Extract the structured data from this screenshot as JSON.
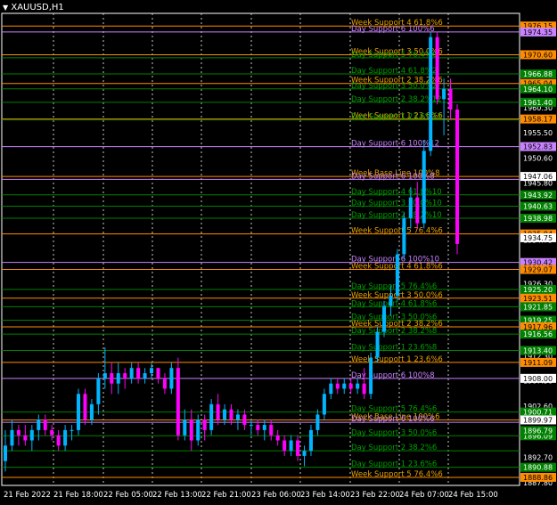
{
  "window": {
    "symbol_label": "XAUUSD,H1",
    "menu_icon": "triangle-down-icon"
  },
  "colors": {
    "background": "#000000",
    "grid": "#c8c8c8",
    "bull": "#00b4ff",
    "bear": "#ff00ff",
    "week_line": "#ff8c00",
    "day_line": "#c882ff",
    "green_line": "#008000",
    "week_text": "#e6a000",
    "day_text": "#c882ff",
    "green_text": "#00a000",
    "badge_green": "#008000",
    "badge_orange": "#ff8c00",
    "badge_violet": "#c882ff",
    "badge_white": "#ffffff"
  },
  "chart_data": {
    "type": "candlestick",
    "symbol": "XAUUSD",
    "timeframe": "H1",
    "ylim": [
      1887.3,
      1978.6
    ],
    "x_tick_labels": [
      "21 Feb 2022",
      "21 Feb 18:00",
      "22 Feb 05:00",
      "22 Feb 13:00",
      "22 Feb 21:00",
      "23 Feb 06:00",
      "23 Feb 14:00",
      "23 Feb 22:00",
      "24 Feb 07:00",
      "24 Feb 15:00"
    ],
    "y_tick_labels": [
      "1960.30",
      "1955.50",
      "1950.60",
      "1945.80",
      "1941.00",
      "1934.75",
      "1926.30",
      "1921.80",
      "1916.90",
      "1912.30",
      "1907.50",
      "1902.60",
      "1897.90",
      "1892.70",
      "1887.80"
    ],
    "levels": [
      {
        "price": 1976.15,
        "style": "week",
        "label": "Week Support 4 61.8%6",
        "badge": "1976.15",
        "badge_style": "orange"
      },
      {
        "price": 1975.0,
        "style": "day",
        "label": "Day Support 6 100%6",
        "badge": "1974.35",
        "badge_style": "violet"
      },
      {
        "price": 1970.6,
        "style": "week",
        "label": "Week Support 3 50.0%6",
        "badge": "1970.60",
        "badge_style": "orange"
      },
      {
        "price": 1970.0,
        "style": "green",
        "label": "Day Support 5 76.4%6",
        "badge": "",
        "badge_style": ""
      },
      {
        "price": 1966.88,
        "style": "green",
        "label": "Day Support 4 61.8%2",
        "badge": "1966.88",
        "badge_style": "green"
      },
      {
        "price": 1965.04,
        "style": "week",
        "label": "Week Support 2 38.2%6",
        "badge": "1965.04",
        "badge_style": "orange"
      },
      {
        "price": 1964.0,
        "style": "green",
        "label": "Day Support 3 50.0%2",
        "badge": "1964.10",
        "badge_style": "green"
      },
      {
        "price": 1961.4,
        "style": "green",
        "label": "Day Support 2 38.2%12",
        "badge": "1961.40",
        "badge_style": "green"
      },
      {
        "price": 1958.17,
        "style": "week",
        "label": "Week Support 1 23.6%6",
        "badge": "1958.17",
        "badge_style": "orange"
      },
      {
        "price": 1958.0,
        "style": "green",
        "label": "Day Support 1 23.6%12",
        "badge": "",
        "badge_style": ""
      },
      {
        "price": 1952.83,
        "style": "day",
        "label": "Day Support 6 100%12",
        "badge": "1952.83",
        "badge_style": "violet"
      },
      {
        "price": 1947.06,
        "style": "week",
        "label": "Week Base Line 100%8",
        "badge": "1947.06",
        "badge_style": "white"
      },
      {
        "price": 1946.5,
        "style": "day",
        "label": "Day Support 6 100%8",
        "badge": "",
        "badge_style": ""
      },
      {
        "price": 1943.5,
        "style": "green",
        "label": "Day Support 4 61.8%10",
        "badge": "1943.92",
        "badge_style": "green"
      },
      {
        "price": 1941.3,
        "style": "green",
        "label": "Day Support 3 50.0%10",
        "badge": "1940.63",
        "badge_style": "green"
      },
      {
        "price": 1938.98,
        "style": "green",
        "label": "Day Support 2 38.2%10",
        "badge": "1938.98",
        "badge_style": "green"
      },
      {
        "price": 1935.94,
        "style": "week",
        "label": "Week Support 5 76.4%6",
        "badge": "1935.94",
        "badge_style": "orange"
      },
      {
        "price": 1930.42,
        "style": "day",
        "label": "Day Support 6 100%10",
        "badge": "1930.42",
        "badge_style": "violet"
      },
      {
        "price": 1929.07,
        "style": "week",
        "label": "Week Support 4 61.8%6",
        "badge": "1929.07",
        "badge_style": "orange"
      },
      {
        "price": 1925.2,
        "style": "green",
        "label": "Day Support 5 76.4%6",
        "badge": "1925.20",
        "badge_style": "green"
      },
      {
        "price": 1923.51,
        "style": "week",
        "label": "Week Support 3 50.0%6",
        "badge": "1923.51",
        "badge_style": "orange"
      },
      {
        "price": 1921.85,
        "style": "green",
        "label": "Day Support 4 61.8%6",
        "badge": "1921.85",
        "badge_style": "green"
      },
      {
        "price": 1919.25,
        "style": "green",
        "label": "Day Support 3 50.0%6",
        "badge": "1919.25",
        "badge_style": "green"
      },
      {
        "price": 1917.96,
        "style": "week",
        "label": "Week Support 2 38.2%6",
        "badge": "1917.96",
        "badge_style": "orange"
      },
      {
        "price": 1916.56,
        "style": "green",
        "label": "Day Support 2 38.2%8",
        "badge": "1916.56",
        "badge_style": "green"
      },
      {
        "price": 1913.4,
        "style": "green",
        "label": "Day Support 1 23.6%8",
        "badge": "1913.40",
        "badge_style": "green"
      },
      {
        "price": 1911.09,
        "style": "week",
        "label": "Week Support 1 23.6%6",
        "badge": "1911.09",
        "badge_style": "orange"
      },
      {
        "price": 1908.0,
        "style": "day",
        "label": "Day Support 6 100%8",
        "badge": "1908.00",
        "badge_style": "white"
      },
      {
        "price": 1901.5,
        "style": "green",
        "label": "Day Support 5 76.4%6",
        "badge": "1900.71",
        "badge_style": "green"
      },
      {
        "price": 1899.97,
        "style": "week",
        "label": "Week Base Line 100%6",
        "badge": "1899.97",
        "badge_style": "white"
      },
      {
        "price": 1899.5,
        "style": "day",
        "label": "Day Support 6 100%6",
        "badge": "",
        "badge_style": ""
      },
      {
        "price": 1896.9,
        "style": "green",
        "label": "Day Support 3 50.0%6",
        "badge": "1896.09",
        "badge_style": "green"
      },
      {
        "price": 1894.0,
        "style": "green",
        "label": "Day Support 2 38.2%6",
        "badge": "",
        "badge_style": ""
      },
      {
        "price": 1890.8,
        "style": "green",
        "label": "Day Support 1 23.6%6",
        "badge": "1890.88",
        "badge_style": "green"
      },
      {
        "price": 1888.86,
        "style": "week",
        "label": "Week Support 5 76.4%6",
        "badge": "1888.86",
        "badge_style": "orange"
      },
      {
        "price": 1935.2,
        "style": "none",
        "label": "",
        "badge": "1934.75",
        "badge_style": "white"
      },
      {
        "price": 1897.9,
        "style": "none",
        "label": "",
        "badge": "1896.79",
        "badge_style": "green"
      }
    ],
    "candles": [
      [
        1892,
        1898,
        1890,
        1895
      ],
      [
        1895,
        1900,
        1894,
        1898
      ],
      [
        1898,
        1899,
        1895,
        1897
      ],
      [
        1897,
        1899,
        1895,
        1896
      ],
      [
        1896,
        1899,
        1894,
        1898
      ],
      [
        1898,
        1901,
        1896,
        1900
      ],
      [
        1900,
        1901,
        1897,
        1898
      ],
      [
        1898,
        1899,
        1896,
        1897
      ],
      [
        1897,
        1898,
        1894,
        1895
      ],
      [
        1895,
        1899,
        1894,
        1898
      ],
      [
        1898,
        1899,
        1896,
        1898
      ],
      [
        1898,
        1906,
        1897,
        1905
      ],
      [
        1905,
        1906,
        1899,
        1900
      ],
      [
        1900,
        1904,
        1899,
        1903
      ],
      [
        1903,
        1909,
        1901,
        1908
      ],
      [
        1908,
        1914,
        1906,
        1909
      ],
      [
        1909,
        1911,
        1905,
        1907
      ],
      [
        1907,
        1911,
        1905,
        1909
      ],
      [
        1909,
        1910,
        1906,
        1908
      ],
      [
        1908,
        1911,
        1907,
        1910
      ],
      [
        1910,
        1911,
        1907,
        1908
      ],
      [
        1908,
        1910,
        1907,
        1909
      ],
      [
        1909,
        1911,
        1908,
        1910
      ],
      [
        1910,
        1910,
        1907,
        1908
      ],
      [
        1908,
        1909,
        1905,
        1906
      ],
      [
        1906,
        1911,
        1905,
        1910
      ],
      [
        1910,
        1912,
        1896,
        1897
      ],
      [
        1897,
        1902,
        1896,
        1900
      ],
      [
        1900,
        1902,
        1894,
        1896
      ],
      [
        1896,
        1901,
        1895,
        1900
      ],
      [
        1900,
        1901,
        1896,
        1898
      ],
      [
        1898,
        1904,
        1897,
        1903
      ],
      [
        1903,
        1905,
        1899,
        1900
      ],
      [
        1900,
        1903,
        1899,
        1902
      ],
      [
        1902,
        1903,
        1899,
        1900
      ],
      [
        1900,
        1902,
        1898,
        1901
      ],
      [
        1901,
        1902,
        1898,
        1899
      ],
      [
        1899,
        1900,
        1897,
        1899
      ],
      [
        1899,
        1900,
        1897,
        1898
      ],
      [
        1898,
        1900,
        1896,
        1899
      ],
      [
        1899,
        1900,
        1896,
        1897
      ],
      [
        1897,
        1898,
        1895,
        1896
      ],
      [
        1896,
        1897,
        1893,
        1894
      ],
      [
        1894,
        1897,
        1893,
        1896
      ],
      [
        1896,
        1897,
        1892,
        1893
      ],
      [
        1893,
        1895,
        1891,
        1894
      ],
      [
        1894,
        1899,
        1893,
        1898
      ],
      [
        1898,
        1902,
        1897,
        1901
      ],
      [
        1901,
        1906,
        1900,
        1905
      ],
      [
        1905,
        1908,
        1904,
        1907
      ],
      [
        1907,
        1908,
        1905,
        1906
      ],
      [
        1906,
        1908,
        1905,
        1907
      ],
      [
        1907,
        1908,
        1905,
        1906
      ],
      [
        1906,
        1908,
        1905,
        1907
      ],
      [
        1907,
        1910,
        1904,
        1905
      ],
      [
        1905,
        1913,
        1904,
        1912
      ],
      [
        1912,
        1918,
        1911,
        1917
      ],
      [
        1917,
        1923,
        1916,
        1922
      ],
      [
        1922,
        1926,
        1920,
        1924
      ],
      [
        1924,
        1933,
        1923,
        1932
      ],
      [
        1932,
        1940,
        1931,
        1939
      ],
      [
        1939,
        1945,
        1937,
        1943
      ],
      [
        1943,
        1946,
        1937,
        1938
      ],
      [
        1938,
        1954,
        1937,
        1952
      ],
      [
        1952,
        1975,
        1951,
        1974
      ],
      [
        1974,
        1975,
        1961,
        1962
      ],
      [
        1962,
        1966,
        1955,
        1964
      ],
      [
        1964,
        1966,
        1958,
        1960
      ],
      [
        1960,
        1961,
        1932,
        1934
      ]
    ]
  }
}
